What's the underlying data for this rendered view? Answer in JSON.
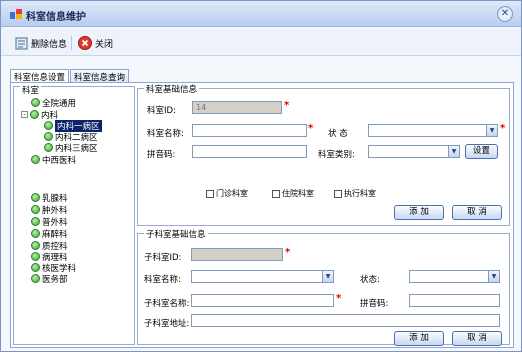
{
  "window": {
    "title": "科室信息维护",
    "close_symbol": "✕"
  },
  "toolbar": {
    "delete_label": "删除信息",
    "close_label": "关闭"
  },
  "tabs": [
    {
      "label": "科室信息设置"
    },
    {
      "label": "科室信息查询"
    }
  ],
  "tree": {
    "legend": "科室",
    "nodes": [
      {
        "label": "全院通用",
        "level": 1
      },
      {
        "label": "内科",
        "level": 1,
        "expander": "-"
      },
      {
        "label": "内科一病区",
        "level": 2,
        "selected": true
      },
      {
        "label": "内科二病区",
        "level": 2
      },
      {
        "label": "内科三病区",
        "level": 2
      },
      {
        "label": "中西医科",
        "level": 1
      },
      {
        "label": "乳腺科",
        "level": 1
      },
      {
        "label": "肿外科",
        "level": 1
      },
      {
        "label": "普外科",
        "level": 1
      },
      {
        "label": "麻醉科",
        "level": 1
      },
      {
        "label": "质控科",
        "level": 1
      },
      {
        "label": "病理科",
        "level": 1
      },
      {
        "label": "核医学科",
        "level": 1
      },
      {
        "label": "医务部",
        "level": 1
      }
    ]
  },
  "basic": {
    "legend": "科室基础信息",
    "id_label": "科室ID:",
    "id_value": "14",
    "name_label": "科室名称:",
    "name_value": "",
    "status_label": "状 态",
    "pinyin_label": "拼音码:",
    "category_label": "科室类别:",
    "set_button": "设置",
    "checkboxes": [
      "门诊科室",
      "住院科室",
      "执行科室"
    ],
    "add_button": "添 加",
    "cancel_button": "取 消"
  },
  "sub": {
    "legend": "子科室基础信息",
    "id_label": "子科室ID:",
    "name_label": "科室名称:",
    "status_label": "状态:",
    "subname_label": "子科室名称:",
    "pinyin_label": "拼音码:",
    "address_label": "子科室地址:",
    "add_button": "添 加",
    "cancel_button": "取 消"
  },
  "required_mark": "*",
  "expander_symbol": "-",
  "dropdown_symbol": "▼"
}
